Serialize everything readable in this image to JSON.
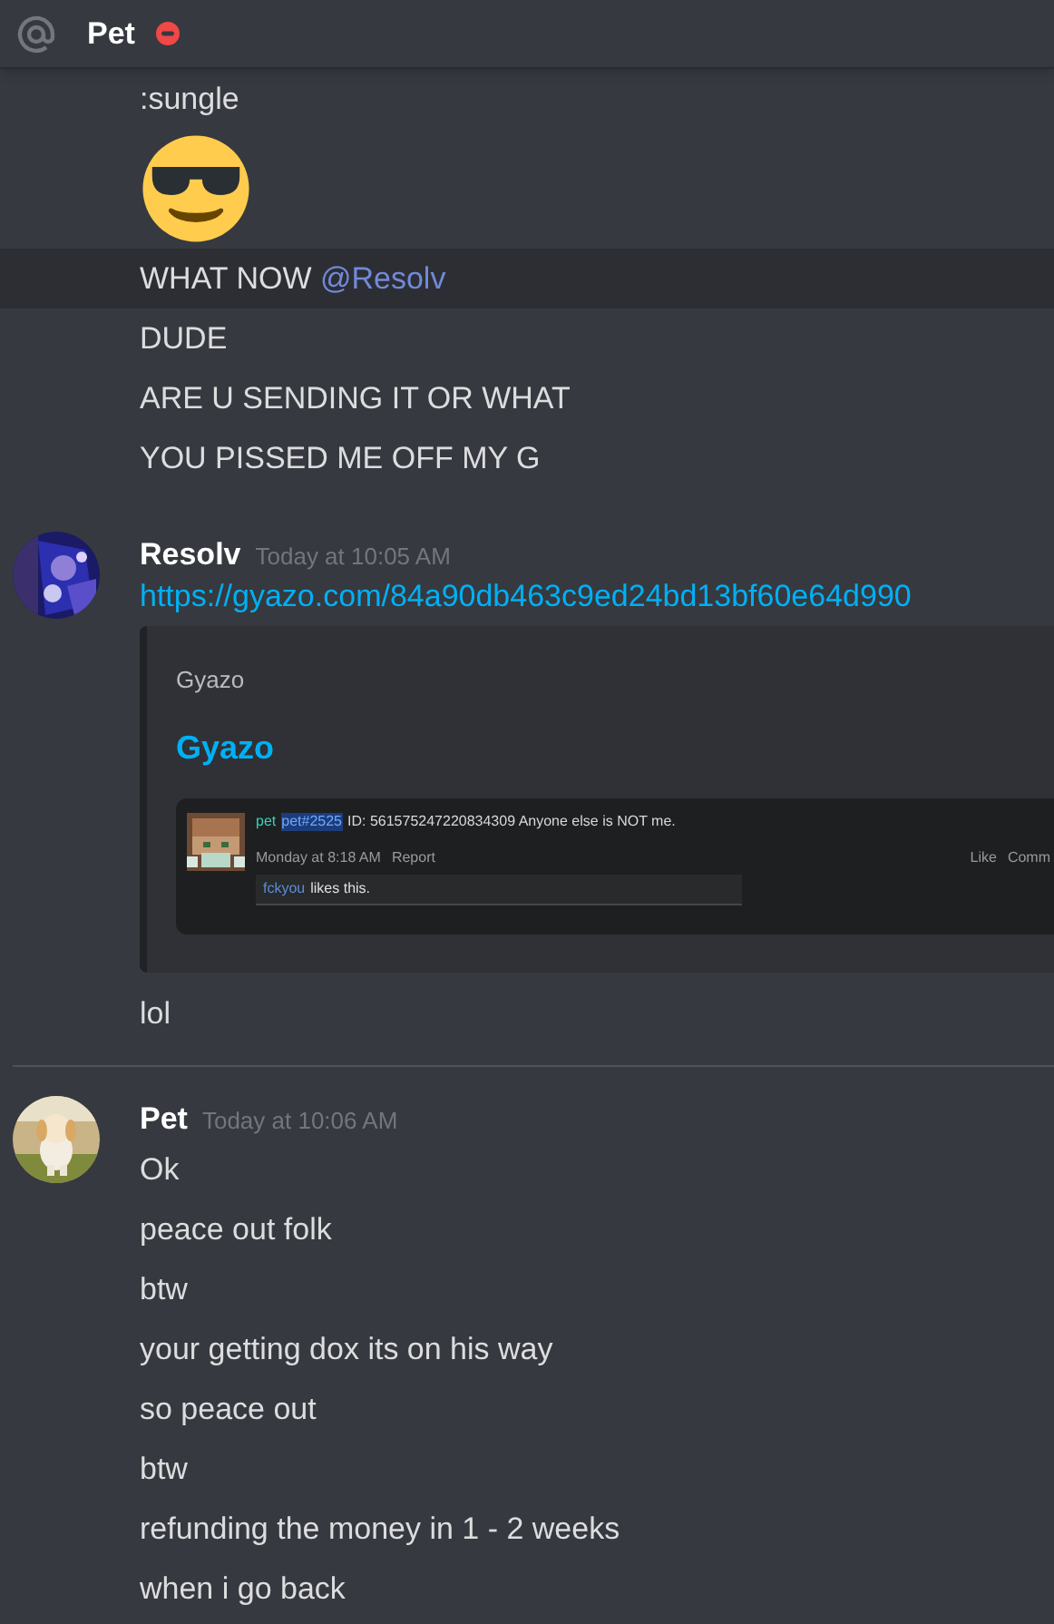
{
  "header": {
    "title": "Pet"
  },
  "messages": [
    {
      "divider_before": false,
      "lines": [
        {
          "kind": "text",
          "text": ":sungle",
          "highlighted": false
        },
        {
          "kind": "emoji",
          "highlighted": false
        },
        {
          "kind": "mention",
          "text": "WHAT NOW ",
          "mention": "@Resolv",
          "highlighted": true
        },
        {
          "kind": "text",
          "text": "DUDE",
          "highlighted": false
        },
        {
          "kind": "text",
          "text": "ARE U SENDING IT OR WHAT",
          "highlighted": false
        },
        {
          "kind": "text",
          "text": "YOU PISSED ME OFF MY G",
          "highlighted": false
        }
      ]
    },
    {
      "divider_before": false,
      "author": "Resolv",
      "timestamp": "Today at 10:05 AM",
      "lines": [
        {
          "kind": "link",
          "text": "https://gyazo.com/84a90db463c9ed24bd13bf60e64d990",
          "highlighted": false
        },
        {
          "kind": "embed",
          "provider": "Gyazo",
          "title": "Gyazo",
          "highlighted": false,
          "image": {
            "post_author": "pet",
            "post_tag": "pet#2525",
            "post_body": "ID: 561575247220834309 Anyone else is NOT me.",
            "time": "Monday at 8:18 AM",
            "report": "Report",
            "actions": [
              "Like",
              "Comm"
            ],
            "liker": "fckyou",
            "likes_text": "likes this."
          }
        },
        {
          "kind": "text",
          "text": "lol",
          "highlighted": false
        }
      ]
    },
    {
      "divider_before": true,
      "author": "Pet",
      "timestamp": "Today at 10:06 AM",
      "lines": [
        {
          "kind": "text",
          "text": "Ok",
          "highlighted": false
        },
        {
          "kind": "text",
          "text": "peace out folk",
          "highlighted": false
        },
        {
          "kind": "text",
          "text": "btw",
          "highlighted": false
        },
        {
          "kind": "text",
          "text": "your getting dox its on his way",
          "highlighted": false
        },
        {
          "kind": "text",
          "text": "so peace out",
          "highlighted": false
        },
        {
          "kind": "text",
          "text": "btw",
          "highlighted": false
        },
        {
          "kind": "text",
          "text": "refunding the money in 1 - 2 weeks",
          "highlighted": false
        },
        {
          "kind": "text",
          "text": "when i go back",
          "highlighted": false
        }
      ]
    }
  ]
}
